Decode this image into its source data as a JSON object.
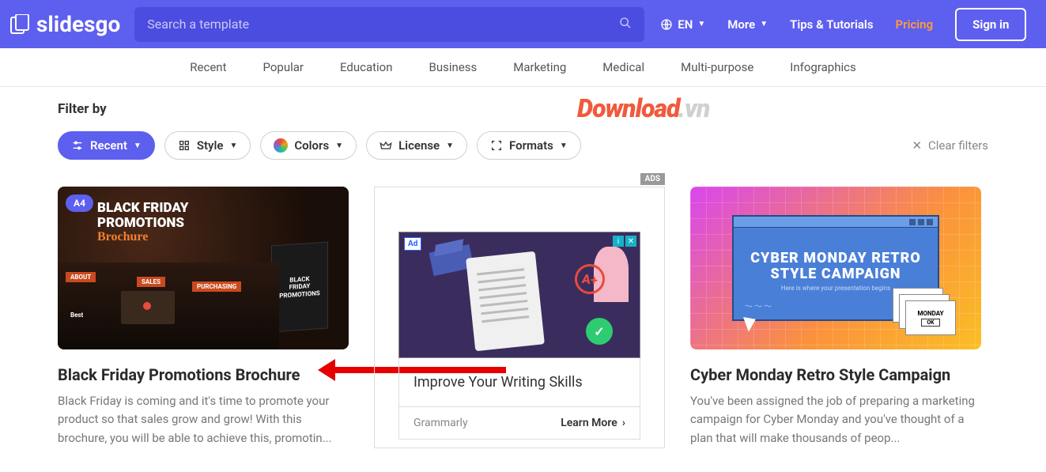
{
  "header": {
    "logo": "slidesgo",
    "search_placeholder": "Search a template",
    "lang": "EN",
    "more": "More",
    "tips": "Tips & Tutorials",
    "pricing": "Pricing",
    "signin": "Sign in"
  },
  "nav": [
    "Recent",
    "Popular",
    "Education",
    "Business",
    "Marketing",
    "Medical",
    "Multi-purpose",
    "Infographics"
  ],
  "watermark": {
    "part1": "Download",
    "part2": ".vn"
  },
  "filters": {
    "label": "Filter by",
    "recent": "Recent",
    "style": "Style",
    "colors": "Colors",
    "license": "License",
    "formats": "Formats",
    "clear": "Clear filters"
  },
  "cards": [
    {
      "badge": "A4",
      "thumb_title_l1": "BLACK FRIDAY",
      "thumb_title_l2": "PROMOTIONS",
      "thumb_brochure": "Brochure",
      "thumb_tri_l1": "BLACK",
      "thumb_tri_l2": "FRIDAY",
      "thumb_tri_l3": "PROMOTIONS",
      "about": "ABOUT",
      "sales": "SALES",
      "purchasing": "PURCHASING",
      "best": "Best",
      "title": "Black Friday Promotions Brochure",
      "desc": "Black Friday is coming and it's time to promote your product so that sales grow and grow! With this brochure, you will be able to achieve this, promotin..."
    },
    {
      "ads_label": "ADS",
      "ad_badge": "Ad",
      "ad_grade": "A+",
      "ad_check": "✓",
      "ad_title": "Improve Your Writing Skills",
      "ad_brand": "Grammarly",
      "ad_cta": "Learn More"
    },
    {
      "thumb_title_l1": "CYBER MONDAY RETRO",
      "thumb_title_l2": "STYLE CAMPAIGN",
      "thumb_sub": "Here is where your presentation begins",
      "thumb_card": "MONDAY",
      "thumb_ok": "OK",
      "title": "Cyber Monday Retro Style Campaign",
      "desc": "You've been assigned the job of preparing a marketing campaign for Cyber Monday and you've thought of a plan that will make thousands of peop..."
    }
  ]
}
